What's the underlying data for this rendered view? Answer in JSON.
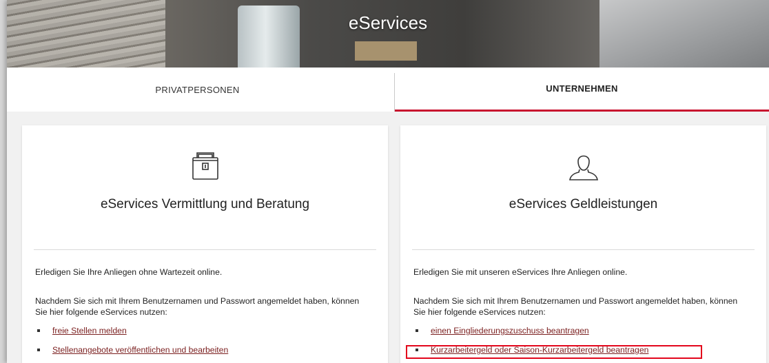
{
  "hero": {
    "title": "eServices"
  },
  "tabs": [
    {
      "label": "PRIVATPERSONEN",
      "active": false
    },
    {
      "label": "UNTERNEHMEN",
      "active": true
    }
  ],
  "colors": {
    "accent": "#c8102e",
    "link": "#7a1e1e",
    "highlight": "#e3051b"
  },
  "cards": [
    {
      "icon": "briefcase-icon",
      "title": "eServices Vermittlung und Beratung",
      "intro": "Erledigen Sie Ihre Anliegen ohne Wartezeit online.",
      "description": "Nachdem Sie sich mit Ihrem Benutzernamen und Passwort angemeldet haben, können Sie hier folgende eServices nutzen:",
      "links": [
        "freie Stellen melden",
        "Stellenangebote veröffentlichen und bearbeiten"
      ]
    },
    {
      "icon": "user-icon",
      "title": "eServices Geldleistungen",
      "intro": "Erledigen Sie mit unseren eServices Ihre Anliegen online.",
      "description": "Nachdem Sie sich mit Ihrem Benutzernamen und Passwort angemeldet haben, können Sie hier folgende eServices nutzen:",
      "links": [
        "einen Eingliederungszuschuss beantragen",
        "Kurzarbeitergeld oder Saison-Kurzarbeitergeld beantragen"
      ]
    }
  ]
}
